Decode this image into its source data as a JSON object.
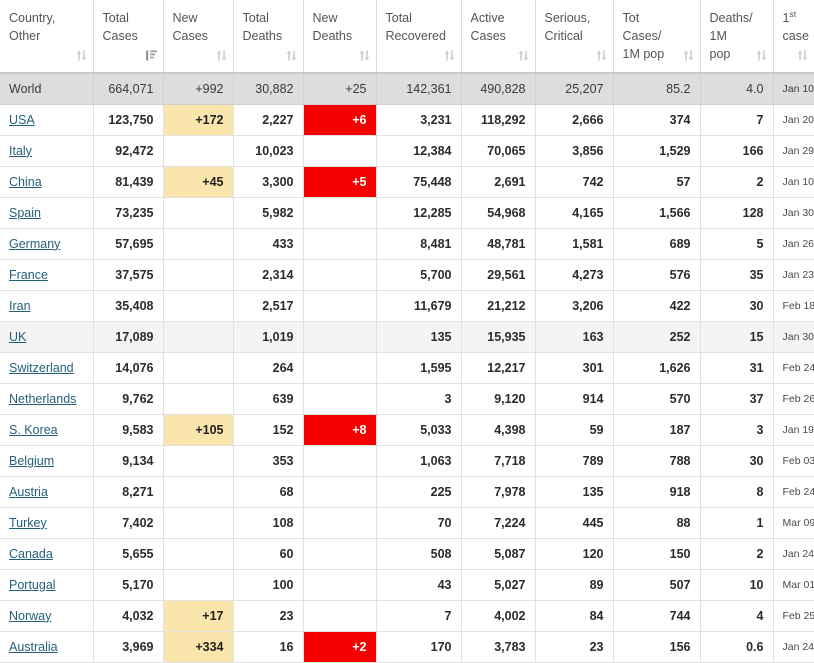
{
  "table": {
    "columns": [
      {
        "label": "Country,\nOther",
        "sort": "both",
        "key": "country"
      },
      {
        "label": "Total\nCases",
        "sort": "desc",
        "key": "total_cases"
      },
      {
        "label": "New\nCases",
        "sort": "both",
        "key": "new_cases"
      },
      {
        "label": "Total\nDeaths",
        "sort": "both",
        "key": "total_deaths"
      },
      {
        "label": "New\nDeaths",
        "sort": "both",
        "key": "new_deaths"
      },
      {
        "label": "Total\nRecovered",
        "sort": "both",
        "key": "total_recovered"
      },
      {
        "label": "Active\nCases",
        "sort": "both",
        "key": "active_cases"
      },
      {
        "label": "Serious,\nCritical",
        "sort": "both",
        "key": "serious_critical"
      },
      {
        "label": "Tot Cases/\n1M pop",
        "sort": "both",
        "key": "tot_cases_per_1m"
      },
      {
        "label": "Deaths/\n1M pop",
        "sort": "both",
        "key": "deaths_per_1m"
      },
      {
        "label": "1|st|\ncase",
        "sort": "both",
        "key": "first_case"
      }
    ],
    "rows": [
      {
        "country": "World",
        "variant": "world",
        "link": false,
        "total_cases": "664,071",
        "new_cases": "+992",
        "new_cases_hl": "none",
        "total_deaths": "30,882",
        "new_deaths": "+25",
        "new_deaths_hl": "none",
        "total_recovered": "142,361",
        "active_cases": "490,828",
        "serious_critical": "25,207",
        "tot_cases_per_1m": "85.2",
        "deaths_per_1m": "4.0",
        "first_case": "Jan 10"
      },
      {
        "country": "USA",
        "variant": "normal",
        "link": true,
        "total_cases": "123,750",
        "new_cases": "+172",
        "new_cases_hl": "yellow",
        "total_deaths": "2,227",
        "new_deaths": "+6",
        "new_deaths_hl": "red",
        "total_recovered": "3,231",
        "active_cases": "118,292",
        "serious_critical": "2,666",
        "tot_cases_per_1m": "374",
        "deaths_per_1m": "7",
        "first_case": "Jan 20"
      },
      {
        "country": "Italy",
        "variant": "normal",
        "link": true,
        "total_cases": "92,472",
        "new_cases": "",
        "new_cases_hl": "none",
        "total_deaths": "10,023",
        "new_deaths": "",
        "new_deaths_hl": "none",
        "total_recovered": "12,384",
        "active_cases": "70,065",
        "serious_critical": "3,856",
        "tot_cases_per_1m": "1,529",
        "deaths_per_1m": "166",
        "first_case": "Jan 29"
      },
      {
        "country": "China",
        "variant": "normal",
        "link": true,
        "total_cases": "81,439",
        "new_cases": "+45",
        "new_cases_hl": "yellow",
        "total_deaths": "3,300",
        "new_deaths": "+5",
        "new_deaths_hl": "red",
        "total_recovered": "75,448",
        "active_cases": "2,691",
        "serious_critical": "742",
        "tot_cases_per_1m": "57",
        "deaths_per_1m": "2",
        "first_case": "Jan 10"
      },
      {
        "country": "Spain",
        "variant": "normal",
        "link": true,
        "total_cases": "73,235",
        "new_cases": "",
        "new_cases_hl": "none",
        "total_deaths": "5,982",
        "new_deaths": "",
        "new_deaths_hl": "none",
        "total_recovered": "12,285",
        "active_cases": "54,968",
        "serious_critical": "4,165",
        "tot_cases_per_1m": "1,566",
        "deaths_per_1m": "128",
        "first_case": "Jan 30"
      },
      {
        "country": "Germany",
        "variant": "normal",
        "link": true,
        "total_cases": "57,695",
        "new_cases": "",
        "new_cases_hl": "none",
        "total_deaths": "433",
        "new_deaths": "",
        "new_deaths_hl": "none",
        "total_recovered": "8,481",
        "active_cases": "48,781",
        "serious_critical": "1,581",
        "tot_cases_per_1m": "689",
        "deaths_per_1m": "5",
        "first_case": "Jan 26"
      },
      {
        "country": "France",
        "variant": "normal",
        "link": true,
        "total_cases": "37,575",
        "new_cases": "",
        "new_cases_hl": "none",
        "total_deaths": "2,314",
        "new_deaths": "",
        "new_deaths_hl": "none",
        "total_recovered": "5,700",
        "active_cases": "29,561",
        "serious_critical": "4,273",
        "tot_cases_per_1m": "576",
        "deaths_per_1m": "35",
        "first_case": "Jan 23"
      },
      {
        "country": "Iran",
        "variant": "normal",
        "link": true,
        "total_cases": "35,408",
        "new_cases": "",
        "new_cases_hl": "none",
        "total_deaths": "2,517",
        "new_deaths": "",
        "new_deaths_hl": "none",
        "total_recovered": "11,679",
        "active_cases": "21,212",
        "serious_critical": "3,206",
        "tot_cases_per_1m": "422",
        "deaths_per_1m": "30",
        "first_case": "Feb 18"
      },
      {
        "country": "UK",
        "variant": "hover",
        "link": true,
        "total_cases": "17,089",
        "new_cases": "",
        "new_cases_hl": "none",
        "total_deaths": "1,019",
        "new_deaths": "",
        "new_deaths_hl": "none",
        "total_recovered": "135",
        "active_cases": "15,935",
        "serious_critical": "163",
        "tot_cases_per_1m": "252",
        "deaths_per_1m": "15",
        "first_case": "Jan 30"
      },
      {
        "country": "Switzerland",
        "variant": "normal",
        "link": true,
        "total_cases": "14,076",
        "new_cases": "",
        "new_cases_hl": "none",
        "total_deaths": "264",
        "new_deaths": "",
        "new_deaths_hl": "none",
        "total_recovered": "1,595",
        "active_cases": "12,217",
        "serious_critical": "301",
        "tot_cases_per_1m": "1,626",
        "deaths_per_1m": "31",
        "first_case": "Feb 24"
      },
      {
        "country": "Netherlands",
        "variant": "normal",
        "link": true,
        "total_cases": "9,762",
        "new_cases": "",
        "new_cases_hl": "none",
        "total_deaths": "639",
        "new_deaths": "",
        "new_deaths_hl": "none",
        "total_recovered": "3",
        "active_cases": "9,120",
        "serious_critical": "914",
        "tot_cases_per_1m": "570",
        "deaths_per_1m": "37",
        "first_case": "Feb 26"
      },
      {
        "country": "S. Korea",
        "variant": "normal",
        "link": true,
        "total_cases": "9,583",
        "new_cases": "+105",
        "new_cases_hl": "yellow",
        "total_deaths": "152",
        "new_deaths": "+8",
        "new_deaths_hl": "red",
        "total_recovered": "5,033",
        "active_cases": "4,398",
        "serious_critical": "59",
        "tot_cases_per_1m": "187",
        "deaths_per_1m": "3",
        "first_case": "Jan 19"
      },
      {
        "country": "Belgium",
        "variant": "normal",
        "link": true,
        "total_cases": "9,134",
        "new_cases": "",
        "new_cases_hl": "none",
        "total_deaths": "353",
        "new_deaths": "",
        "new_deaths_hl": "none",
        "total_recovered": "1,063",
        "active_cases": "7,718",
        "serious_critical": "789",
        "tot_cases_per_1m": "788",
        "deaths_per_1m": "30",
        "first_case": "Feb 03"
      },
      {
        "country": "Austria",
        "variant": "normal",
        "link": true,
        "total_cases": "8,271",
        "new_cases": "",
        "new_cases_hl": "none",
        "total_deaths": "68",
        "new_deaths": "",
        "new_deaths_hl": "none",
        "total_recovered": "225",
        "active_cases": "7,978",
        "serious_critical": "135",
        "tot_cases_per_1m": "918",
        "deaths_per_1m": "8",
        "first_case": "Feb 24"
      },
      {
        "country": "Turkey",
        "variant": "normal",
        "link": true,
        "total_cases": "7,402",
        "new_cases": "",
        "new_cases_hl": "none",
        "total_deaths": "108",
        "new_deaths": "",
        "new_deaths_hl": "none",
        "total_recovered": "70",
        "active_cases": "7,224",
        "serious_critical": "445",
        "tot_cases_per_1m": "88",
        "deaths_per_1m": "1",
        "first_case": "Mar 09"
      },
      {
        "country": "Canada",
        "variant": "normal",
        "link": true,
        "total_cases": "5,655",
        "new_cases": "",
        "new_cases_hl": "none",
        "total_deaths": "60",
        "new_deaths": "",
        "new_deaths_hl": "none",
        "total_recovered": "508",
        "active_cases": "5,087",
        "serious_critical": "120",
        "tot_cases_per_1m": "150",
        "deaths_per_1m": "2",
        "first_case": "Jan 24"
      },
      {
        "country": "Portugal",
        "variant": "normal",
        "link": true,
        "total_cases": "5,170",
        "new_cases": "",
        "new_cases_hl": "none",
        "total_deaths": "100",
        "new_deaths": "",
        "new_deaths_hl": "none",
        "total_recovered": "43",
        "active_cases": "5,027",
        "serious_critical": "89",
        "tot_cases_per_1m": "507",
        "deaths_per_1m": "10",
        "first_case": "Mar 01"
      },
      {
        "country": "Norway",
        "variant": "normal",
        "link": true,
        "total_cases": "4,032",
        "new_cases": "+17",
        "new_cases_hl": "yellow",
        "total_deaths": "23",
        "new_deaths": "",
        "new_deaths_hl": "none",
        "total_recovered": "7",
        "active_cases": "4,002",
        "serious_critical": "84",
        "tot_cases_per_1m": "744",
        "deaths_per_1m": "4",
        "first_case": "Feb 25"
      },
      {
        "country": "Australia",
        "variant": "normal",
        "link": true,
        "total_cases": "3,969",
        "new_cases": "+334",
        "new_cases_hl": "yellow",
        "total_deaths": "16",
        "new_deaths": "+2",
        "new_deaths_hl": "red",
        "total_recovered": "170",
        "active_cases": "3,783",
        "serious_critical": "23",
        "tot_cases_per_1m": "156",
        "deaths_per_1m": "0.6",
        "first_case": "Jan 24"
      }
    ]
  },
  "colors": {
    "highlight_yellow": "#fae5ad",
    "highlight_red": "#f70000",
    "world_row_bg": "#dddddd",
    "hover_row_bg": "#f4f4f4",
    "link": "#24607a",
    "border": "#e2e2e2"
  }
}
